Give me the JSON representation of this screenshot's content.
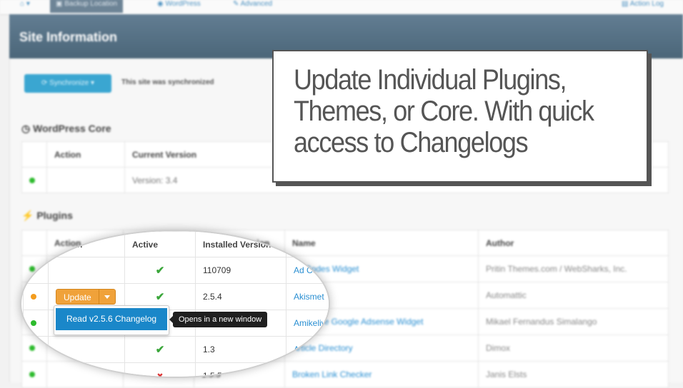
{
  "nav": {
    "tabs": [
      {
        "label": "",
        "icon": "home-icon"
      },
      {
        "label": "Backup Location",
        "icon": "database-icon"
      },
      {
        "label": "WordPress",
        "icon": "wordpress-icon"
      },
      {
        "label": "Advanced",
        "icon": "wrench-icon"
      }
    ],
    "right_link": "Action Log"
  },
  "header": {
    "title": "Site Information"
  },
  "sync": {
    "button_label": "Synchronize",
    "status_text": "This site was synchronized"
  },
  "core": {
    "heading": "WordPress Core",
    "columns": [
      "",
      "Action",
      "Current Version"
    ],
    "rows": [
      {
        "status": "green",
        "version": "Version: 3.4"
      }
    ]
  },
  "plugins": {
    "heading": "Plugins",
    "columns": [
      "",
      "Action",
      "Active",
      "Installed Version",
      "Name",
      "Author"
    ],
    "rows": [
      {
        "status": "green",
        "action": "",
        "active": "check",
        "version": "110709",
        "name": "Ad Codes Widget",
        "author": "Pritin Themes.com / WebSharks, Inc."
      },
      {
        "status": "orange",
        "action": "Update",
        "active": "check",
        "version": "2.5.4",
        "name": "Akismet",
        "author": "Automattic"
      },
      {
        "status": "green",
        "action": "",
        "active": "check",
        "version": "",
        "name": "Amikelive Google Adsense Widget",
        "author": "Mikael Fernandus Simalango"
      },
      {
        "status": "green",
        "action": "",
        "active": "check",
        "version": "1.3",
        "name": "Article Directory",
        "author": "Dimox"
      },
      {
        "status": "green",
        "action": "",
        "active": "cross",
        "version": "1.5.5",
        "name": "Broken Link Checker",
        "author": "Janis Elsts"
      }
    ]
  },
  "dropdown": {
    "item": "Read v2.5.6 Changelog"
  },
  "tooltip": {
    "text": "Opens in a new window"
  },
  "callout": {
    "text": "Update Individual Plugins, Themes, or Core. With quick access to Changelogs"
  },
  "colors": {
    "header": "#5a7488",
    "accent": "#1a87c9",
    "update": "#f0a23a",
    "ok": "#2dbb2d",
    "warn": "#f39c1e"
  }
}
